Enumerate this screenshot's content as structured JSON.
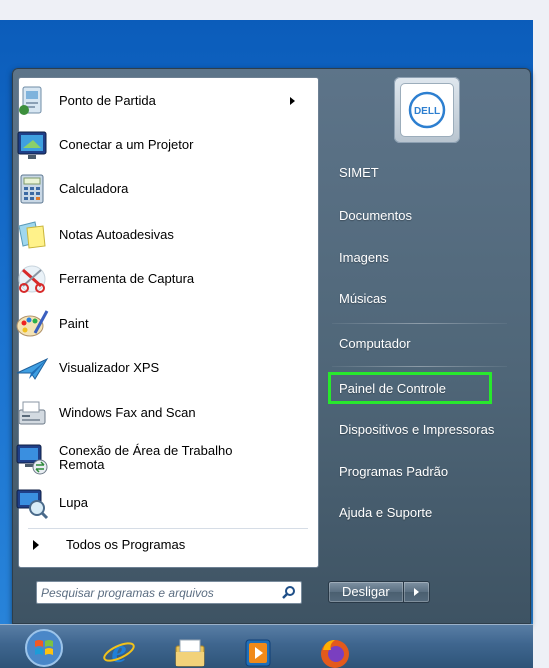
{
  "start_menu": {
    "programs": [
      {
        "label": "Ponto de Partida",
        "icon": "getting-started-icon",
        "has_submenu": true
      },
      {
        "label": "Conectar a um Projetor",
        "icon": "projector-icon"
      },
      {
        "label": "Calculadora",
        "icon": "calculator-icon"
      },
      {
        "label": "Notas Autoadesivas",
        "icon": "sticky-notes-icon"
      },
      {
        "label": "Ferramenta de Captura",
        "icon": "snipping-tool-icon"
      },
      {
        "label": "Paint",
        "icon": "paint-icon"
      },
      {
        "label": "Visualizador XPS",
        "icon": "xps-viewer-icon"
      },
      {
        "label": "Windows Fax and Scan",
        "icon": "fax-scan-icon"
      },
      {
        "label": "Conexão de Área de Trabalho",
        "label2": "Remota",
        "icon": "remote-desktop-icon"
      },
      {
        "label": "Lupa",
        "icon": "magnifier-icon"
      }
    ],
    "all_programs_label": "Todos os Programas",
    "search_placeholder": "Pesquisar programas e arquivos",
    "user_picture_logo": "DELL",
    "right_items": [
      {
        "label": "SIMET"
      },
      {
        "label": "Documentos"
      },
      {
        "label": "Imagens"
      },
      {
        "label": "Músicas"
      },
      {
        "label": "Computador"
      },
      {
        "label": "Painel de Controle",
        "highlighted": true
      },
      {
        "label": "Dispositivos e Impressoras"
      },
      {
        "label": "Programas Padrão"
      },
      {
        "label": "Ajuda e Suporte"
      }
    ],
    "shutdown_label": "Desligar",
    "highlight_color": "#28e82d"
  },
  "taskbar": {
    "items": [
      "start-orb-icon",
      "internet-explorer-icon",
      "windows-explorer-icon",
      "media-player-icon",
      "firefox-icon"
    ]
  }
}
